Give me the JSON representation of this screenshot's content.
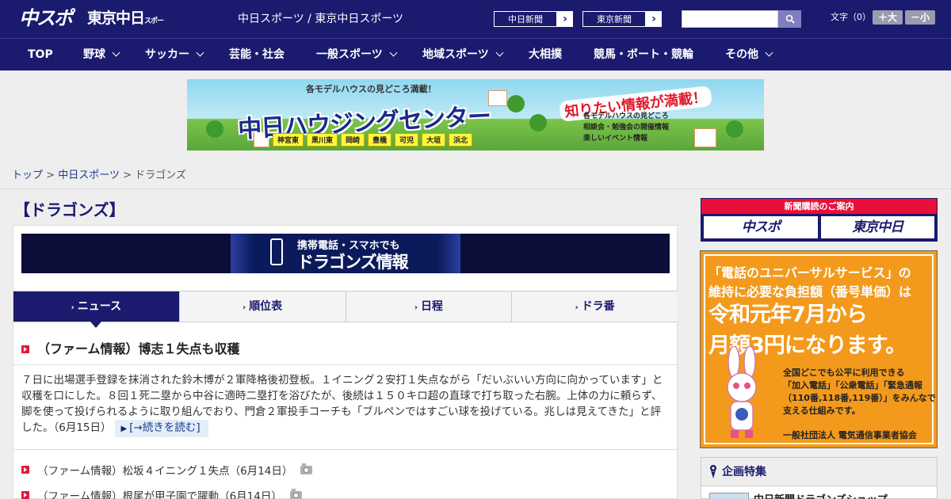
{
  "header": {
    "logo_chuspo": "中スポ",
    "logo_tokyo": "東京中日",
    "logo_tokyo_small": "スポーツ",
    "site_title": "中日スポーツ / 東京中日スポーツ",
    "paper_links": [
      {
        "label": "中日新聞",
        "arrow": "›"
      },
      {
        "label": "東京新聞",
        "arrow": "›"
      }
    ],
    "search_value": "",
    "font_size_label": "文字（0）",
    "font_increase": "＋大",
    "font_decrease": "－小"
  },
  "nav": {
    "items": [
      {
        "label": "TOP",
        "has_menu": false
      },
      {
        "label": "野球",
        "has_menu": true
      },
      {
        "label": "サッカー",
        "has_menu": true
      },
      {
        "label": "芸能・社会",
        "has_menu": false
      },
      {
        "label": "一般スポーツ",
        "has_menu": true
      },
      {
        "label": "地域スポーツ",
        "has_menu": true
      },
      {
        "label": "大相撲",
        "has_menu": false
      },
      {
        "label": "競馬・ボート・競輪",
        "has_menu": false
      },
      {
        "label": "その他",
        "has_menu": true
      }
    ]
  },
  "banner_ad": {
    "top_text": "各モデルハウスの見どころ満載！",
    "main_text": "中日ハウジングセンター",
    "right_text": "知りたい情報が満載！",
    "points": [
      "各モデルハウスの見どころ",
      "相談会・勉強会の開催情報",
      "楽しいイベント情報"
    ],
    "cities": [
      "神宮東",
      "黒川東",
      "岡崎",
      "豊橋",
      "可児",
      "大垣",
      "浜北"
    ]
  },
  "breadcrumb": {
    "home": "トップ",
    "section": "中日スポーツ",
    "current": "ドラゴンズ",
    "separator": ">"
  },
  "main": {
    "heading": "【ドラゴンズ】",
    "mobile_banner": {
      "line1": "携帯電話・スマホでも",
      "line2": "ドラゴンズ情報"
    },
    "tabs": [
      {
        "label": "ニュース",
        "active": true
      },
      {
        "label": "順位表",
        "active": false
      },
      {
        "label": "日程",
        "active": false
      },
      {
        "label": "ドラ番",
        "active": false
      }
    ],
    "lead": {
      "title": "（ファーム情報）博志１失点も収穫",
      "body": "７日に出場選手登録を抹消された鈴木博が２軍降格後初登板。１イニング２安打１失点ながら「だいぶいい方向に向かっています」と収穫を口にした。８回１死二塁から中谷に適時二塁打を浴びたが、後続は１５０キロ超の直球で打ち取った右腕。上体の力に頼らず、脚を使って投げられるように取り組んでおり、門倉２軍投手コーチも「ブルペンではすごい球を投げている。兆しは見えてきた」と評した。（6月15日）",
      "read_more": "[→続きを読む]"
    },
    "news_list": [
      {
        "title": "（ファーム情報）松坂４イニング１失点（6月14日）",
        "has_photo": true
      },
      {
        "title": "（ファーム情報）根尾が甲子園で躍動（6月14日）",
        "has_photo": true
      }
    ]
  },
  "sidebar": {
    "subscribe": {
      "heading": "新聞購読のご案内",
      "logos": [
        "中スポ",
        "東京中日"
      ]
    },
    "ad": {
      "line1": "「電話のユニバーサルサービス」の",
      "line1b": "維持に必要な負担額（番号単価）は",
      "line2": "令和元年7月から",
      "line2b": "月額3円になります。",
      "body": [
        "全国どこでも公平に利用できる",
        "「加入電話」「公衆電話」「緊急通報",
        "（110番,118番,119番）」をみんなで",
        "支える仕組みです。"
      ],
      "sponsor": "一般社団法人 電気通信事業者協会"
    },
    "features": {
      "heading": "企画特集",
      "item": "中日新聞ドラゴンズショップ"
    }
  },
  "colors": {
    "brand_navy": "#1a1a6e",
    "accent_red": "#e01a3a",
    "ad_orange": "#f39a1c"
  }
}
